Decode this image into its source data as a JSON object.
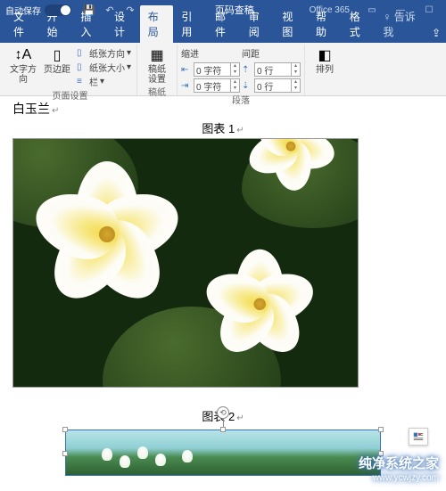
{
  "titlebar": {
    "autosave_label": "自动保存",
    "doc_title": "页码查稿",
    "product": "Office 365"
  },
  "tabs": {
    "file": "文件",
    "home": "开始",
    "insert": "插入",
    "design": "设计",
    "layout": "布局",
    "references": "引用",
    "mailings": "邮件",
    "review": "审阅",
    "view": "视图",
    "help": "帮助",
    "format": "格式",
    "tellme": "告诉我"
  },
  "ribbon": {
    "page_setup": {
      "text_direction": "文字方向",
      "margins": "页边距",
      "orientation": "纸张方向",
      "size": "纸张大小",
      "columns": "栏",
      "group_label": "页面设置"
    },
    "manuscript": {
      "settings": "稿纸\n设置",
      "group_label": "稿纸"
    },
    "paragraph": {
      "indent_label": "缩进",
      "spacing_label": "间距",
      "indent_left": "0 字符",
      "indent_right": "0 字符",
      "space_before": "0 行",
      "space_after": "0 行",
      "group_label": "段落"
    },
    "arrange": {
      "arrange": "排列"
    }
  },
  "document": {
    "heading": "白玉兰",
    "caption1_prefix": "图表 ",
    "caption1_num": "1",
    "caption2_prefix": "图表 ",
    "caption2_num": "2"
  },
  "watermark": {
    "line1": "纯净系统之家",
    "line2": "www.ycwjzy.com"
  }
}
